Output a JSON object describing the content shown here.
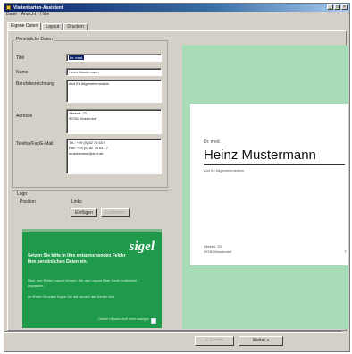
{
  "window": {
    "title": "Visitenkarten-Assistent"
  },
  "menu": [
    "Datei",
    "Ansicht",
    "Hilfe"
  ],
  "tabs": [
    {
      "label": "Eigene Daten",
      "active": true
    },
    {
      "label": "Layout",
      "active": false
    },
    {
      "label": "Drucken",
      "active": false
    }
  ],
  "form": {
    "group_title": "Persönliche Daten",
    "fields": [
      {
        "label": "Titel",
        "value": "Dr. med."
      },
      {
        "label": "Name",
        "value": "Heinz Mustermann"
      },
      {
        "label": "Berufsbezeichnung",
        "value": "Arzt für Allgemeinmedizin"
      },
      {
        "label": "Adresse",
        "value": "Alleestr. 20\n99781 Musterdorf"
      },
      {
        "label": "Telefon/Fax/E-Mail",
        "value": "Tel.: +49 (0) 82 75 63 0\nFax: +49 (0) 82 75 63 17\nmustermann@arzt.de"
      }
    ]
  },
  "logo": {
    "group_title": "Logo",
    "position_label": "Position",
    "position_value": "Links",
    "add_button": "Einfügen",
    "remove_button": "Entfernen"
  },
  "ad": {
    "brand": "sigel",
    "headline": "Setzen Sie bitte in Ihre entsprechenden Felder Ihre persönlichen Daten ein.",
    "body_1": "Über den Reiter Layout können Sie das Layout Ihrer Karte individuell anpassen.",
    "body_2": "Im Reiter Drucken legen Sie die Anzahl der Karten fest.",
    "footer": "Diesen Hinweis nicht mehr anzeigen"
  },
  "preview": {
    "role": "Dr. med.",
    "name": "Heinz Mustermann",
    "subtitle": "Arzt für Allgemeinmedizin",
    "address": "Alleestr. 20\n99781 Musterdorf",
    "more": "T"
  },
  "footer": {
    "back_button": "< Zurück",
    "next_button": "Weiter >"
  },
  "colors": {
    "ad_green": "#1e9a4a",
    "preview_green": "#a8dcb8"
  }
}
